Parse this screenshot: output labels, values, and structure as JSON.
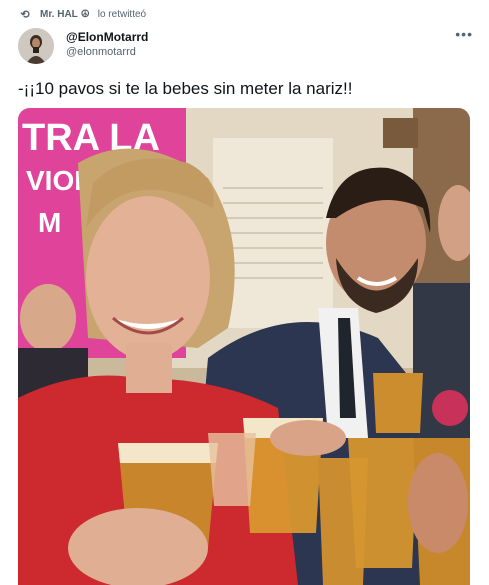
{
  "retweet": {
    "icon": "retweet-icon",
    "user": "Mr. HAL",
    "user_badge": "peace-symbol-icon",
    "action": "lo retwitteó"
  },
  "tweet": {
    "display_name": "@ElonMotarrd",
    "handle": "@elonmotarrd",
    "more_icon": "more-horizontal-icon",
    "text": "-¡¡10 pavos si te la bebes sin meter la nariz!!"
  },
  "photo": {
    "sign_lines": [
      "TRA LA",
      "VIOL",
      "M"
    ]
  },
  "colors": {
    "text_primary": "#0f1419",
    "text_secondary": "#536471",
    "sign_pink": "#e0439a"
  }
}
